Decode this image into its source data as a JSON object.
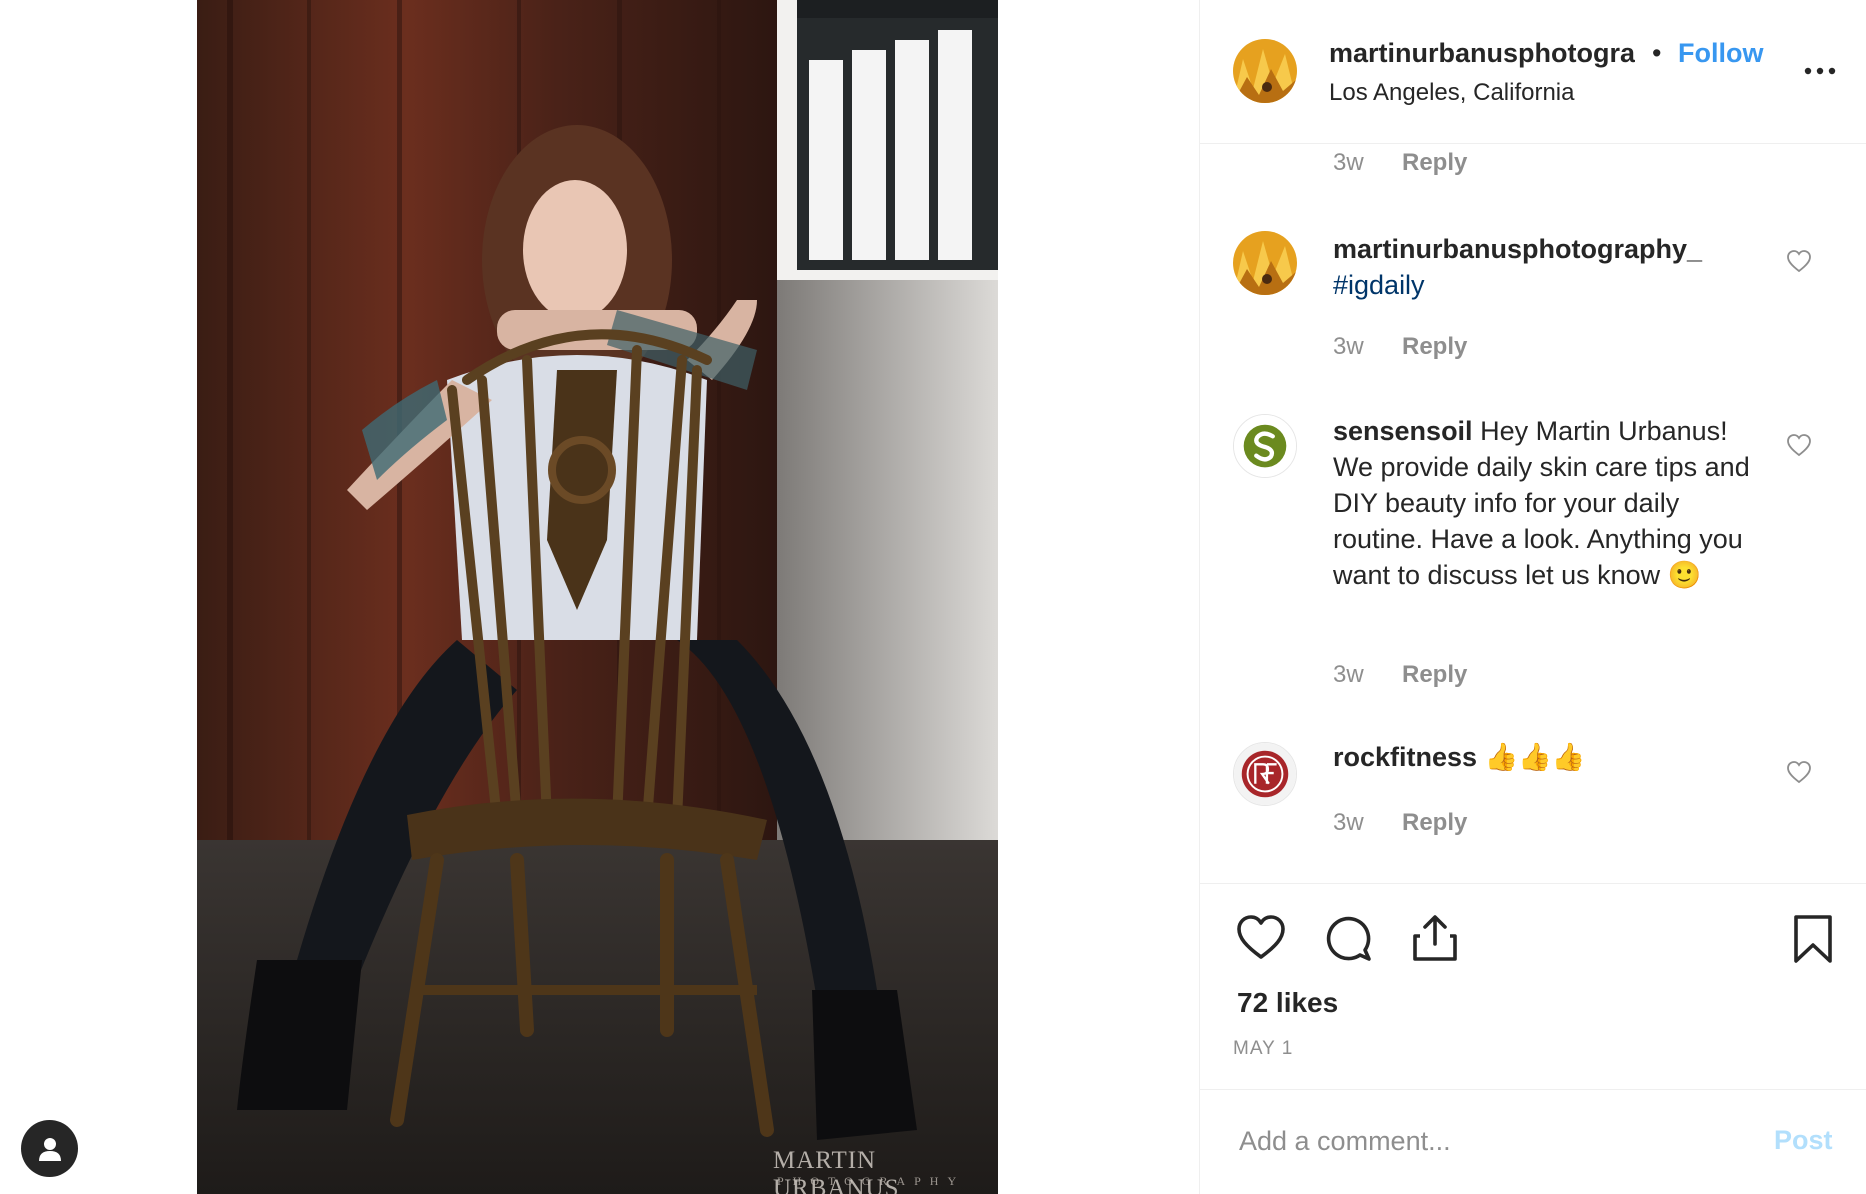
{
  "post": {
    "username": "martinurbanusphotogra",
    "dot": "•",
    "follow_label": "Follow",
    "location": "Los Angeles, California",
    "more_icon": "more-horizontal-icon"
  },
  "photo": {
    "watermark_line1": "MARTIN URBANUS",
    "watermark_line2": "PHOTOGRAPHY"
  },
  "comments": [
    {
      "time": "3w",
      "reply_label": "Reply"
    },
    {
      "username": "martinurbanusphotography_",
      "text": "#igdaily",
      "time": "3w",
      "reply_label": "Reply"
    },
    {
      "username": "sensensoil",
      "text": "Hey Martin Urbanus! We provide daily skin care tips and DIY beauty info for your daily routine. Have a look. Anything you want to discuss let us know",
      "emoji": "🙂",
      "time": "3w",
      "reply_label": "Reply"
    },
    {
      "username": "rockfitness",
      "text": "👍👍👍",
      "time": "3w",
      "reply_label": "Reply"
    }
  ],
  "actions": {
    "like_icon": "heart-icon",
    "comment_icon": "comment-bubble-icon",
    "share_icon": "share-icon",
    "save_icon": "bookmark-icon",
    "likes": "72 likes",
    "date": "MAY 1"
  },
  "add_comment": {
    "placeholder": "Add a comment...",
    "post_label": "Post"
  },
  "colors": {
    "link": "#3897f0",
    "hashtag": "#003569",
    "muted": "#8e8e8e",
    "post_disabled": "#b2dffc"
  }
}
